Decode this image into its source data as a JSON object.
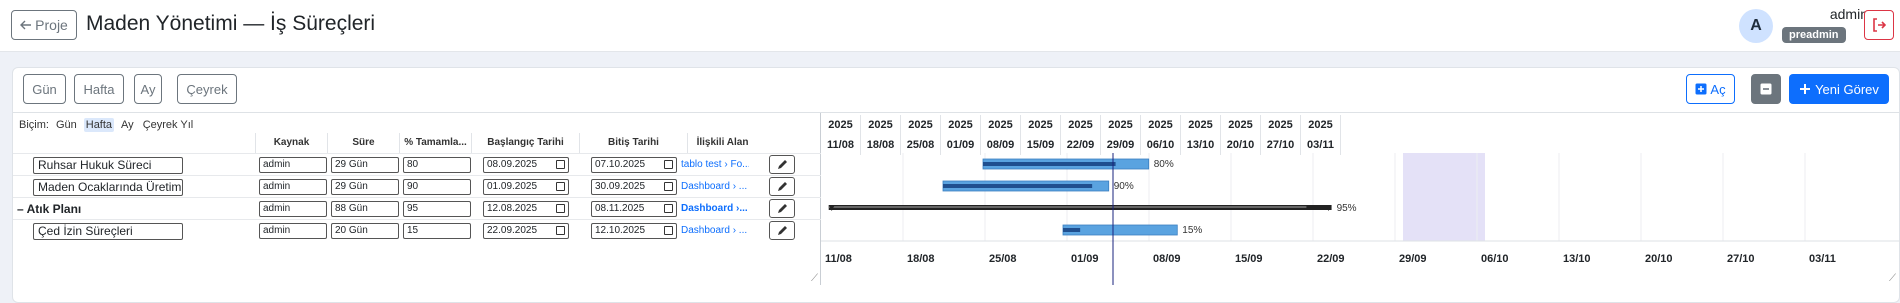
{
  "header": {
    "back_label": "Proje",
    "title": "Maden Yönetimi — İş Süreçleri",
    "avatar_initial": "A",
    "user_name": "admin",
    "user_role": "preadmin"
  },
  "toolbar": {
    "views": [
      "Gün",
      "Hafta",
      "Ay",
      "Çeyrek"
    ],
    "expand_label": "Aç",
    "new_task_label": "Yeni Görev"
  },
  "gantt": {
    "format_label": "Biçim:",
    "formats": [
      "Gün",
      "Hafta",
      "Ay",
      "Çeyrek Yıl"
    ],
    "active_format": "Hafta",
    "columns": [
      "Kaynak",
      "Süre",
      "% Tamamla...",
      "Başlangıç Tarihi",
      "Bitiş Tarihi",
      "İlişkili Alan"
    ],
    "tasks": [
      {
        "name": "Ruhsar Hukuk Süreci",
        "resource": "admin",
        "duration": "29 Gün",
        "percent": "80",
        "start": "08.09.2025",
        "end": "07.10.2025",
        "related": "tablo test › Fo...",
        "bar_label": "80%",
        "progress": 0.8
      },
      {
        "name": "Maden Ocaklarında Üretim",
        "resource": "admin",
        "duration": "29 Gün",
        "percent": "90",
        "start": "01.09.2025",
        "end": "30.09.2025",
        "related": "Dashboard › ...",
        "bar_label": "90%",
        "progress": 0.9
      },
      {
        "name": "Atık Planı",
        "group": true,
        "resource": "admin",
        "duration": "88 Gün",
        "percent": "95",
        "start": "12.08.2025",
        "end": "08.11.2025",
        "related": "Dashboard ›...",
        "bar_label": "95%",
        "progress": 0.95
      },
      {
        "name": "Çed İzin Süreçleri",
        "resource": "admin",
        "duration": "20 Gün",
        "percent": "15",
        "start": "22.09.2025",
        "end": "12.10.2025",
        "related": "Dashboard › ...",
        "bar_label": "15%",
        "progress": 0.15
      }
    ],
    "group_prefix": "–",
    "timeline_years": [
      "2025",
      "2025",
      "2025",
      "2025",
      "2025",
      "2025",
      "2025",
      "2025",
      "2025",
      "2025",
      "2025",
      "2025",
      "2025"
    ],
    "timeline_weeks": [
      "11/08",
      "18/08",
      "25/08",
      "01/09",
      "08/09",
      "15/09",
      "22/09",
      "29/09",
      "06/10",
      "13/10",
      "20/10",
      "27/10",
      "03/11"
    ],
    "bottom_labels": [
      "11/08",
      "18/08",
      "25/08",
      "01/09",
      "08/09",
      "15/09",
      "22/09",
      "29/09",
      "06/10",
      "13/10",
      "20/10",
      "27/10",
      "03/11"
    ]
  }
}
